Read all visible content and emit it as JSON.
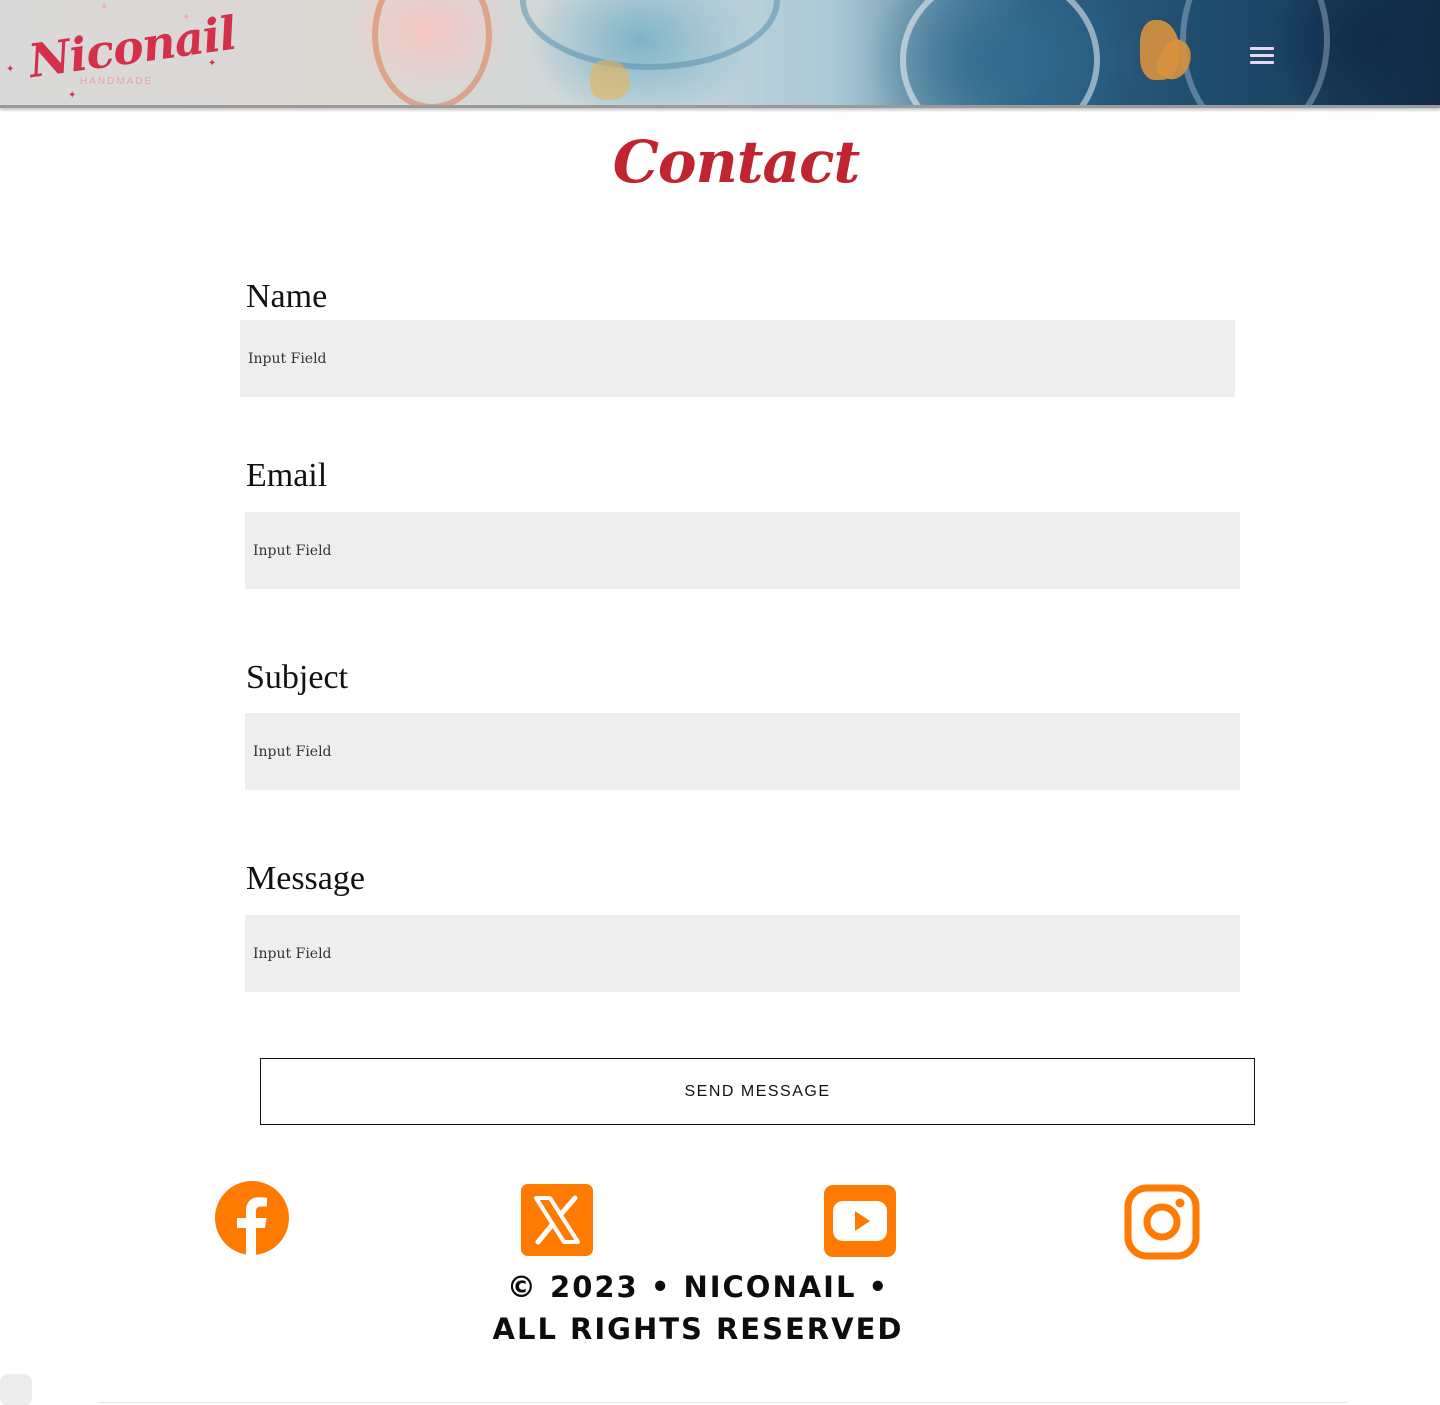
{
  "header": {
    "logo_text": "Niconail",
    "logo_subtext": "HANDMADE",
    "menu_icon": "hamburger-menu-icon"
  },
  "page": {
    "title": "Contact"
  },
  "form": {
    "fields": [
      {
        "label": "Name",
        "placeholder": "Input Field"
      },
      {
        "label": "Email",
        "placeholder": "Input Field"
      },
      {
        "label": "Subject",
        "placeholder": "Input Field"
      },
      {
        "label": "Message",
        "placeholder": "Input Field"
      }
    ],
    "submit_label": "SEND MESSAGE"
  },
  "social": {
    "accent_color": "#ff7a00",
    "icons": [
      "facebook-icon",
      "x-icon",
      "youtube-icon",
      "instagram-icon"
    ]
  },
  "footer": {
    "line1": "© 2023 • NICONAIL •",
    "line2": "ALL RIGHTS RESERVED"
  }
}
